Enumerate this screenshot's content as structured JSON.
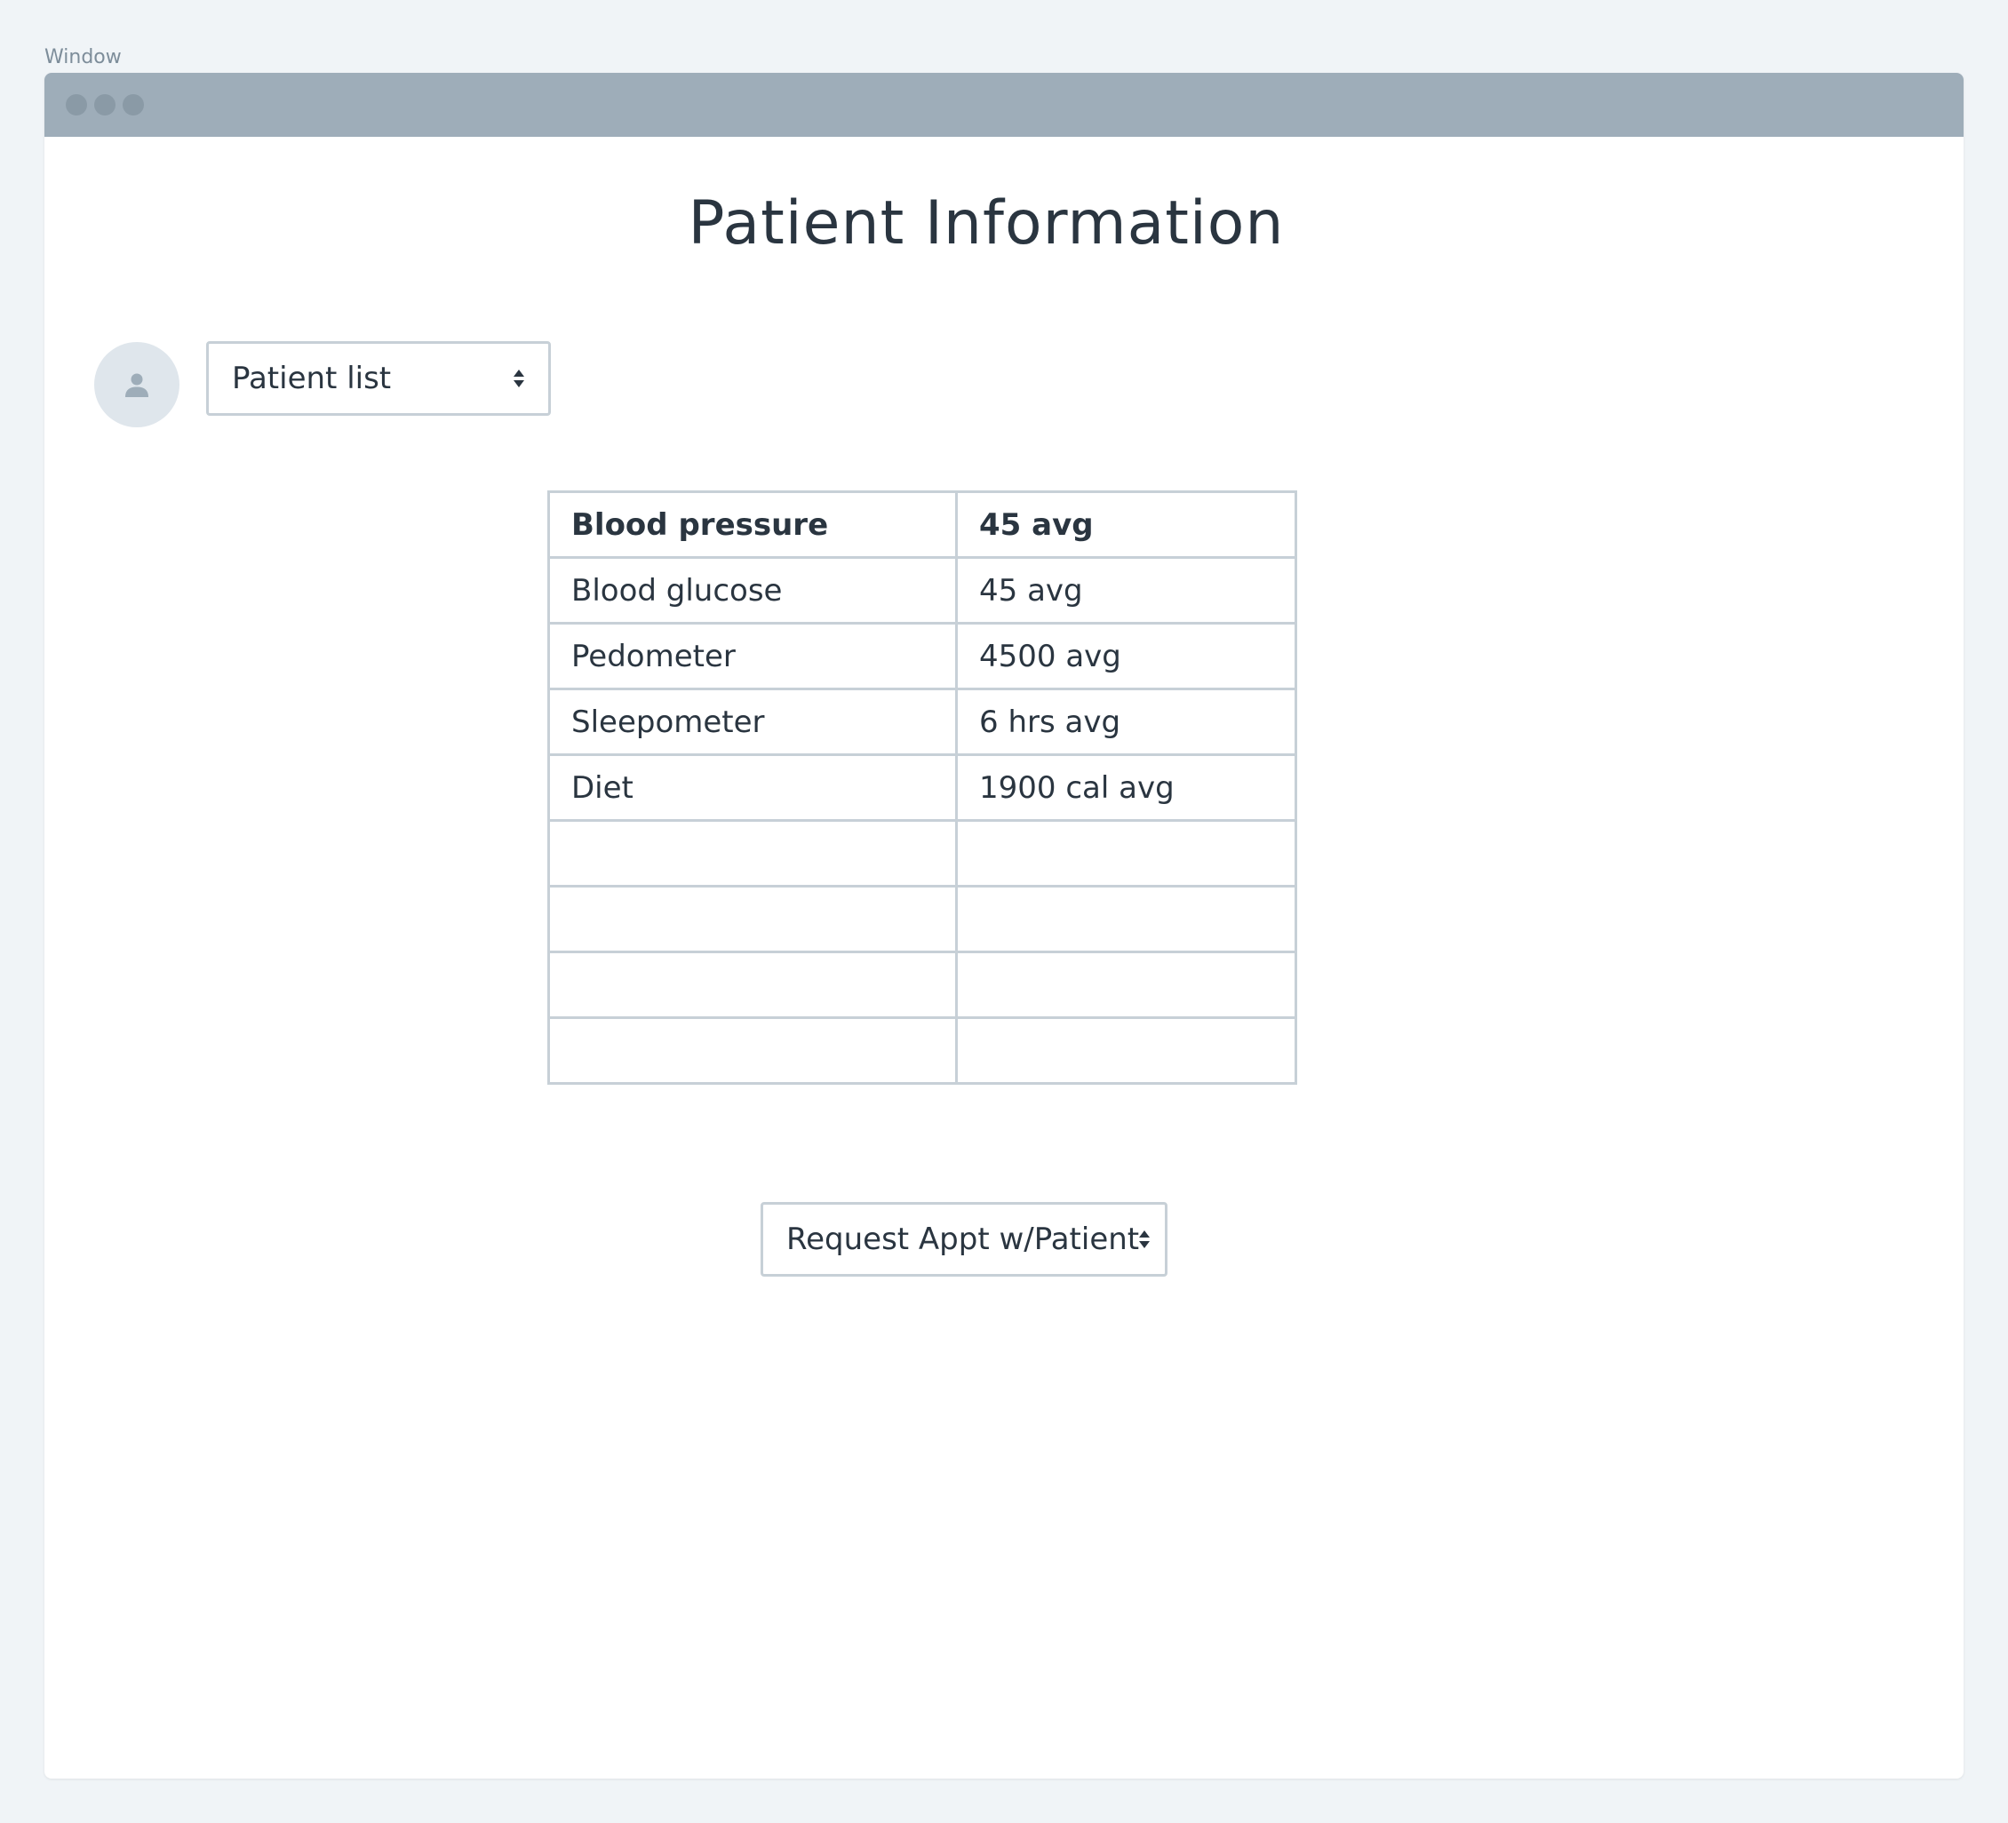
{
  "window": {
    "caption": "Window"
  },
  "page": {
    "title": "Patient Information"
  },
  "patient_select": {
    "label": "Patient list"
  },
  "metrics_table": {
    "rows": [
      {
        "metric": "Blood pressure",
        "value": "45 avg"
      },
      {
        "metric": "Blood glucose",
        "value": "45 avg"
      },
      {
        "metric": "Pedometer",
        "value": "4500 avg"
      },
      {
        "metric": "Sleepometer",
        "value": "6 hrs avg"
      },
      {
        "metric": "Diet",
        "value": "1900 cal avg"
      },
      {
        "metric": "",
        "value": ""
      },
      {
        "metric": "",
        "value": ""
      },
      {
        "metric": "",
        "value": ""
      },
      {
        "metric": "",
        "value": ""
      }
    ]
  },
  "appointment_select": {
    "label": "Request Appt w/Patient"
  },
  "icons": {
    "avatar": "user-icon",
    "select_arrows": "updown-arrows-icon"
  },
  "colors": {
    "background": "#f0f4f7",
    "titlebar": "#9eadb9",
    "border": "#c7d0d7",
    "text": "#2a3540"
  }
}
